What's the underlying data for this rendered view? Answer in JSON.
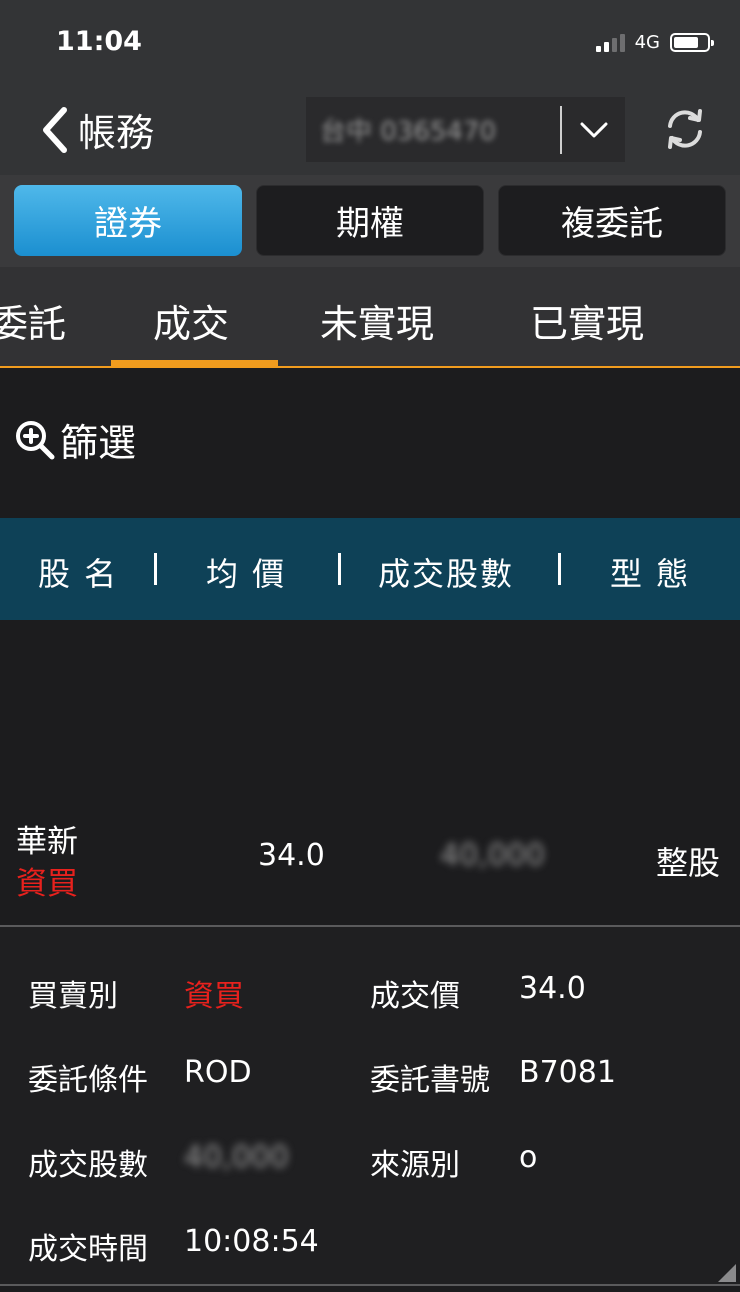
{
  "status_bar": {
    "time": "11:04",
    "network": "4G",
    "signal_bars_active": 2,
    "signal_bars_total": 4
  },
  "nav": {
    "back_title": "帳務",
    "account_text": "台中 0365470",
    "icons": {
      "back": "chevron-left-icon",
      "dropdown": "chevron-down-icon",
      "refresh": "refresh-icon"
    }
  },
  "segments": [
    {
      "label": "證券",
      "active": true
    },
    {
      "label": "期權",
      "active": false
    },
    {
      "label": "複委託",
      "active": false
    }
  ],
  "sub_tabs": [
    {
      "label": "委託",
      "active": false
    },
    {
      "label": "成交",
      "active": true
    },
    {
      "label": "未實現",
      "active": false
    },
    {
      "label": "已實現",
      "active": false
    }
  ],
  "filter": {
    "label": "篩選",
    "icon": "zoom-in-icon"
  },
  "table": {
    "headers": [
      "股 名",
      "均 價",
      "成交股數",
      "型 態"
    ],
    "row": {
      "name": "華新",
      "side": "資買",
      "price": "34.0",
      "qty": "40,000",
      "type": "整股"
    }
  },
  "detail": {
    "items": [
      {
        "label": "買賣別",
        "value": "資買"
      },
      {
        "label": "成交價",
        "value": "34.0"
      },
      {
        "label": "委託條件",
        "value": "ROD"
      },
      {
        "label": "委託書號",
        "value": "B7081"
      },
      {
        "label": "成交股數",
        "value": "40,000"
      },
      {
        "label": "來源別",
        "value": "o"
      },
      {
        "label": "成交時間",
        "value": "10:08:54"
      }
    ]
  },
  "colors": {
    "accent_orange": "#f19c1e",
    "active_blue": "#1b8fd0",
    "table_header": "#0e4157",
    "buy_red": "#e8211d"
  }
}
